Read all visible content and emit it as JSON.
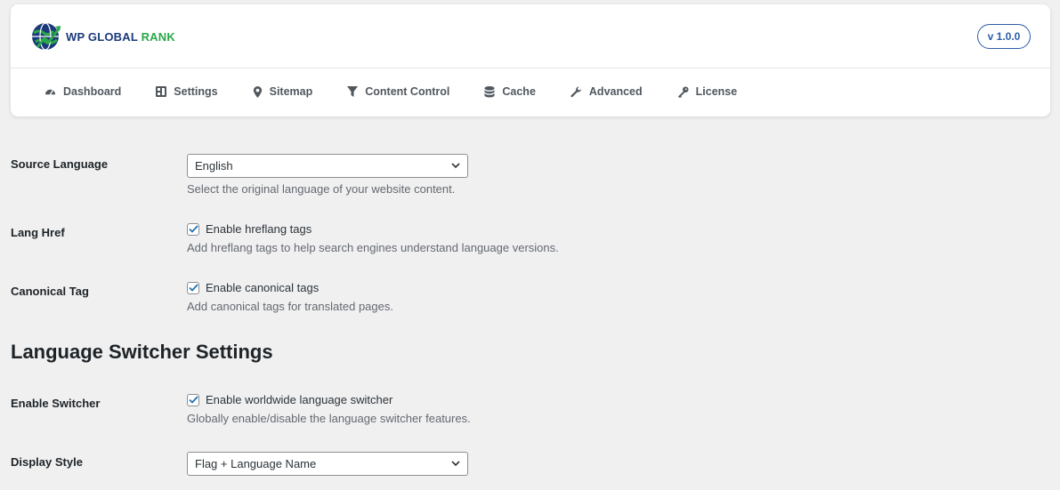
{
  "brand": {
    "word_primary": "WP GLOBAL",
    "word_accent": "RANK",
    "version": "v 1.0.0",
    "colors": {
      "primary": "#1b3a7a",
      "accent": "#2aa84a",
      "badge": "#2b5da8"
    }
  },
  "nav": {
    "items": [
      {
        "label": "Dashboard",
        "icon": "dashboard-icon"
      },
      {
        "label": "Settings",
        "icon": "grid-icon"
      },
      {
        "label": "Sitemap",
        "icon": "location-pin-icon"
      },
      {
        "label": "Content Control",
        "icon": "filter-icon"
      },
      {
        "label": "Cache",
        "icon": "database-icon"
      },
      {
        "label": "Advanced",
        "icon": "wrench-icon"
      },
      {
        "label": "License",
        "icon": "key-icon"
      }
    ]
  },
  "settings": {
    "source_language": {
      "label": "Source Language",
      "value": "English",
      "description": "Select the original language of your website content."
    },
    "lang_href": {
      "label": "Lang Href",
      "checkbox_label": "Enable hreflang tags",
      "checked": true,
      "description": "Add hreflang tags to help search engines understand language versions."
    },
    "canonical_tag": {
      "label": "Canonical Tag",
      "checkbox_label": "Enable canonical tags",
      "checked": true,
      "description": "Add canonical tags for translated pages."
    }
  },
  "switcher": {
    "title": "Language Switcher Settings",
    "enable": {
      "label": "Enable Switcher",
      "checkbox_label": "Enable worldwide language switcher",
      "checked": true,
      "description": "Globally enable/disable the language switcher features."
    },
    "display_style": {
      "label": "Display Style",
      "value": "Flag + Language Name"
    }
  }
}
